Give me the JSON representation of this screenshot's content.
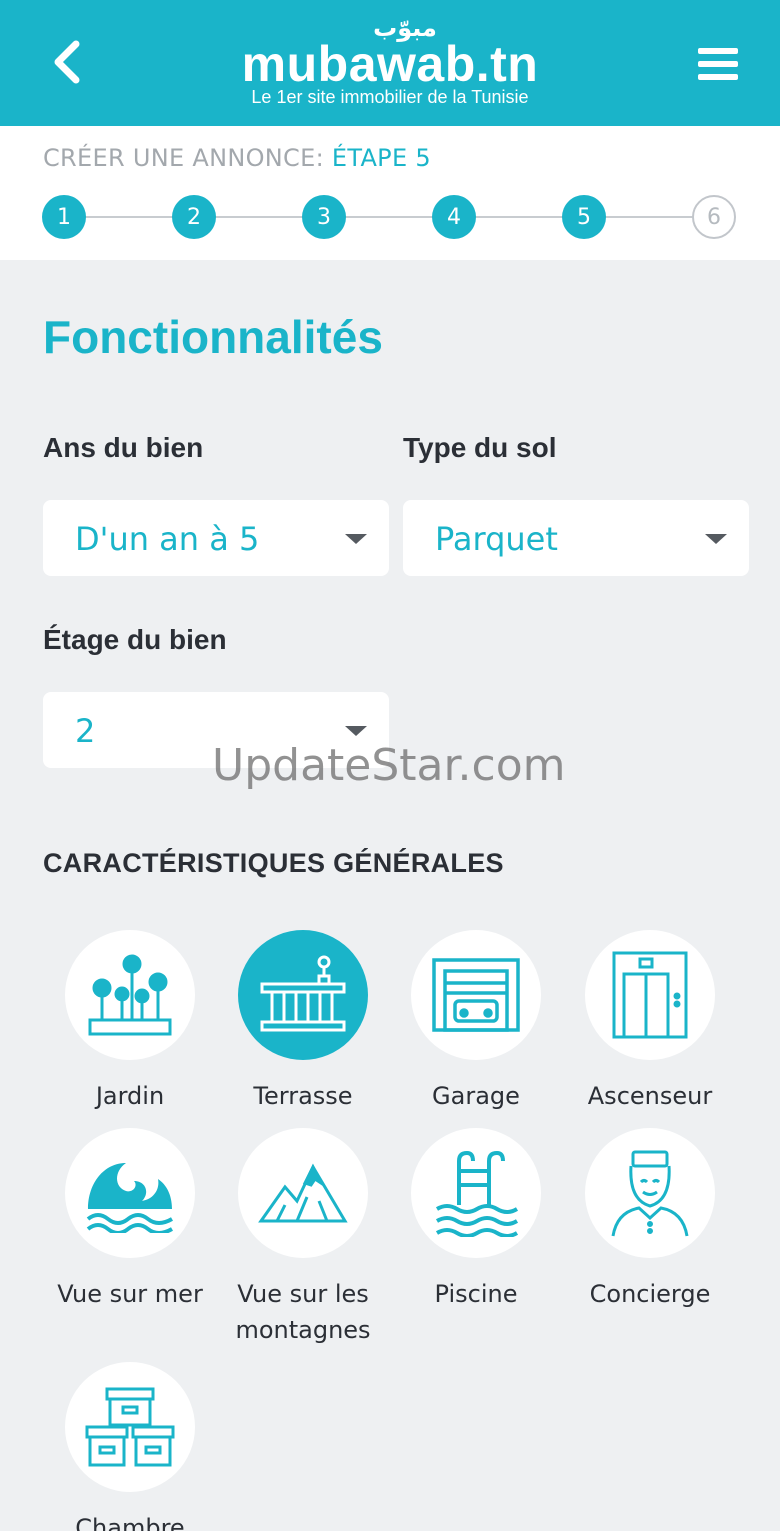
{
  "header": {
    "back_icon": "chevron-left-icon",
    "logo_arabic": "مبوّب",
    "logo_text": "mubawab.tn",
    "tagline": "Le 1er site immobilier de la Tunisie",
    "menu_icon": "hamburger-menu-icon"
  },
  "stepper": {
    "title_prefix": "CRÉER UNE ANNONCE:",
    "title_step": "ÉTAPE 5",
    "current_step": 5,
    "steps": [
      {
        "label": "1",
        "state": "done"
      },
      {
        "label": "2",
        "state": "done"
      },
      {
        "label": "3",
        "state": "done"
      },
      {
        "label": "4",
        "state": "done"
      },
      {
        "label": "5",
        "state": "current"
      },
      {
        "label": "6",
        "state": "pending"
      }
    ]
  },
  "main": {
    "title": "Fonctionnalités",
    "fields": {
      "age": {
        "label": "Ans du bien",
        "value": "D'un an à 5"
      },
      "floor_type": {
        "label": "Type du sol",
        "value": "Parquet"
      },
      "storey": {
        "label": "Étage du bien",
        "value": "2"
      }
    },
    "watermark": "UpdateStar.com",
    "features_heading": "CARACTÉRISTIQUES GÉNÉRALES",
    "features": [
      {
        "label": "Jardin",
        "icon": "garden-icon",
        "selected": false
      },
      {
        "label": "Terrasse",
        "icon": "terrace-icon",
        "selected": true
      },
      {
        "label": "Garage",
        "icon": "garage-icon",
        "selected": false
      },
      {
        "label": "Ascenseur",
        "icon": "elevator-icon",
        "selected": false
      },
      {
        "label": "Vue sur mer",
        "icon": "sea-view-icon",
        "selected": false
      },
      {
        "label": "Vue sur les montagnes",
        "icon": "mountain-view-icon",
        "selected": false
      },
      {
        "label": "Piscine",
        "icon": "pool-icon",
        "selected": false
      },
      {
        "label": "Concierge",
        "icon": "concierge-icon",
        "selected": false
      },
      {
        "label": "Chambre",
        "icon": "storage-room-icon",
        "selected": false
      }
    ]
  },
  "colors": {
    "accent": "#1ab4c9",
    "background": "#eef0f2",
    "text": "#2b2f36"
  }
}
